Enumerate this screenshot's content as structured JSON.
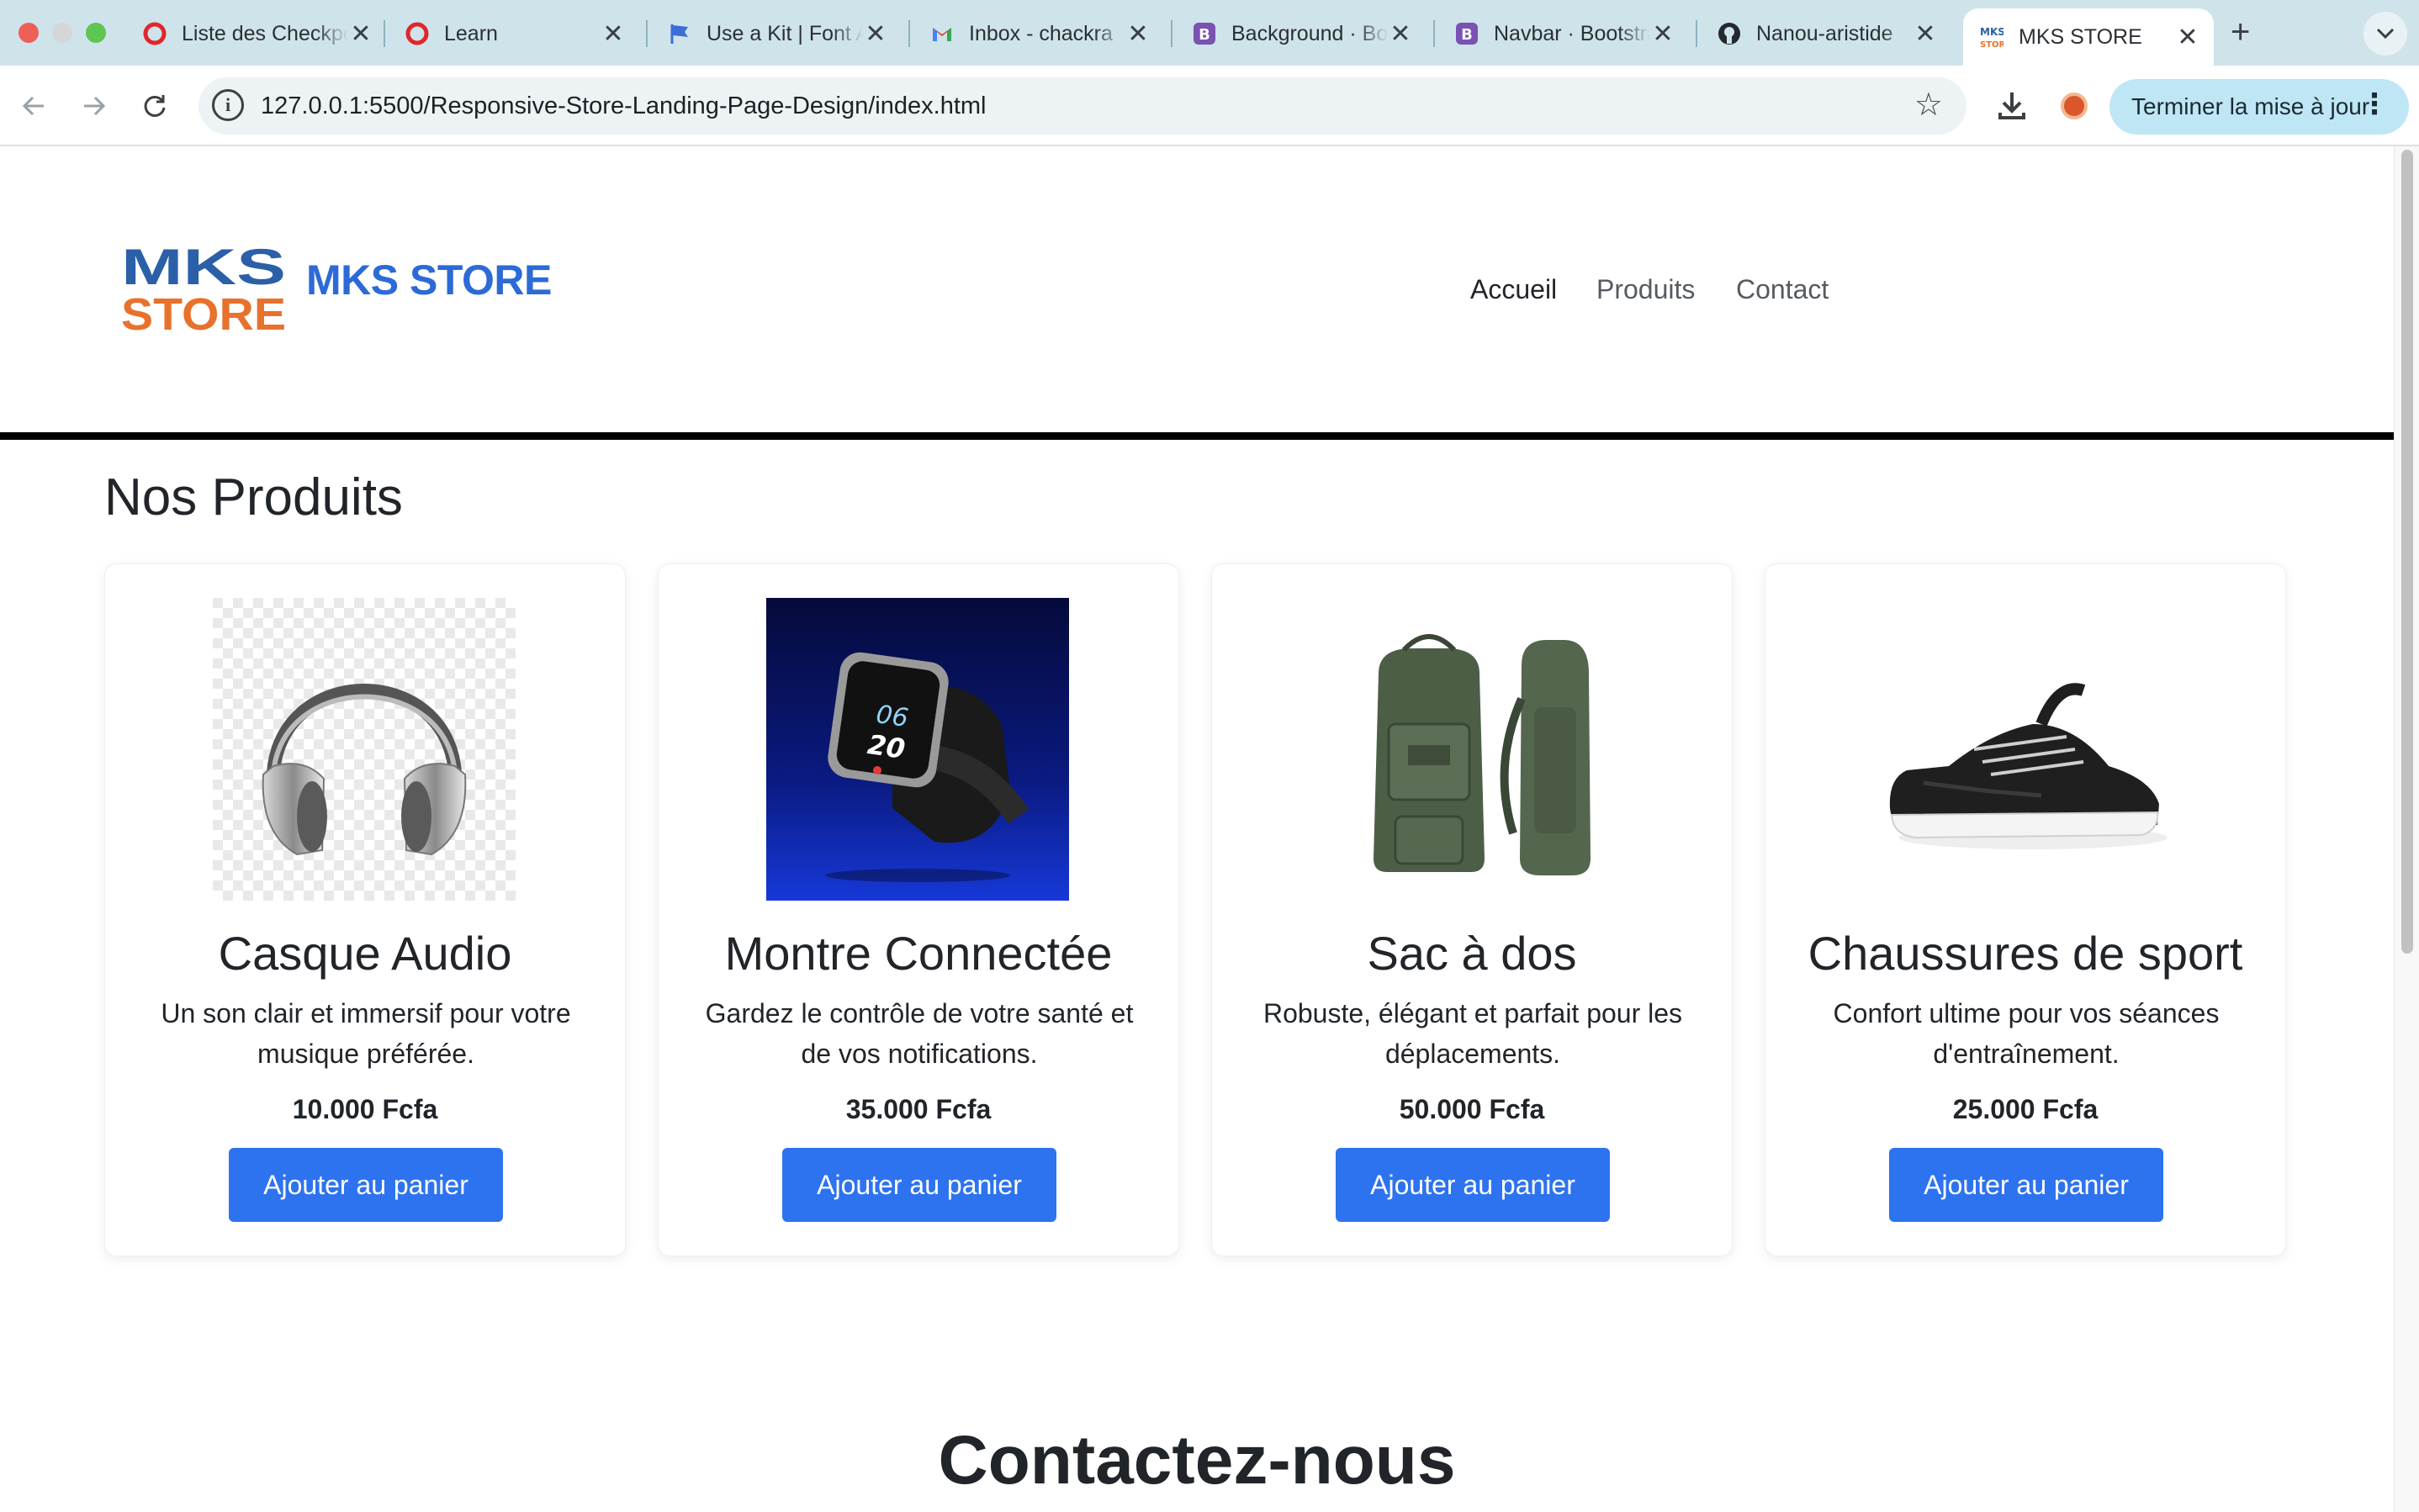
{
  "browser": {
    "tabs": [
      {
        "title": "Liste des Checkpoints",
        "icon": "opera-icon",
        "active": false
      },
      {
        "title": "Learn",
        "icon": "opera-icon",
        "active": false
      },
      {
        "title": "Use a Kit | Font Awesome",
        "icon": "flag-icon",
        "active": false
      },
      {
        "title": "Inbox - chackra",
        "icon": "gmail-icon",
        "active": false
      },
      {
        "title": "Background · Bootstrap",
        "icon": "bootstrap-icon",
        "active": false
      },
      {
        "title": "Navbar · Bootstrap",
        "icon": "bootstrap-icon",
        "active": false
      },
      {
        "title": "Nanou-aristide",
        "icon": "github-icon",
        "active": false
      },
      {
        "title": "MKS STORE",
        "icon": "mks-favicon",
        "active": true
      }
    ],
    "close_glyph": "✕",
    "new_tab_glyph": "+",
    "url": "127.0.0.1:5500/Responsive-Store-Landing-Page-Design/index.html",
    "update_button": "Terminer la mise à jour"
  },
  "site": {
    "logo": {
      "line1": "MKS",
      "line2": "STORE"
    },
    "brand": "MKS STORE",
    "nav": [
      "Accueil",
      "Produits",
      "Contact"
    ],
    "section_title": "Nos Produits",
    "products": [
      {
        "name": "Casque Audio",
        "description": "Un son clair et immersif pour votre musique préférée.",
        "price": "10.000 Fcfa",
        "button": "Ajouter au panier",
        "image": "headphones-image"
      },
      {
        "name": "Montre Connectée",
        "description": "Gardez le contrôle de votre santé et de vos notifications.",
        "price": "35.000 Fcfa",
        "button": "Ajouter au panier",
        "image": "smartwatch-image"
      },
      {
        "name": "Sac à dos",
        "description": "Robuste, élégant et parfait pour les déplacements.",
        "price": "50.000 Fcfa",
        "button": "Ajouter au panier",
        "image": "backpack-image"
      },
      {
        "name": "Chaussures de sport",
        "description": "Confort ultime pour vos séances d'entraînement.",
        "price": "25.000 Fcfa",
        "button": "Ajouter au panier",
        "image": "sneaker-image"
      }
    ],
    "watch_time": {
      "hour": "06",
      "minute": "20"
    },
    "contact_title": "Contactez-nous"
  },
  "colors": {
    "brand_blue": "#2c6ad6",
    "button_blue": "#2d73f0",
    "logo_orange": "#e8712c"
  }
}
